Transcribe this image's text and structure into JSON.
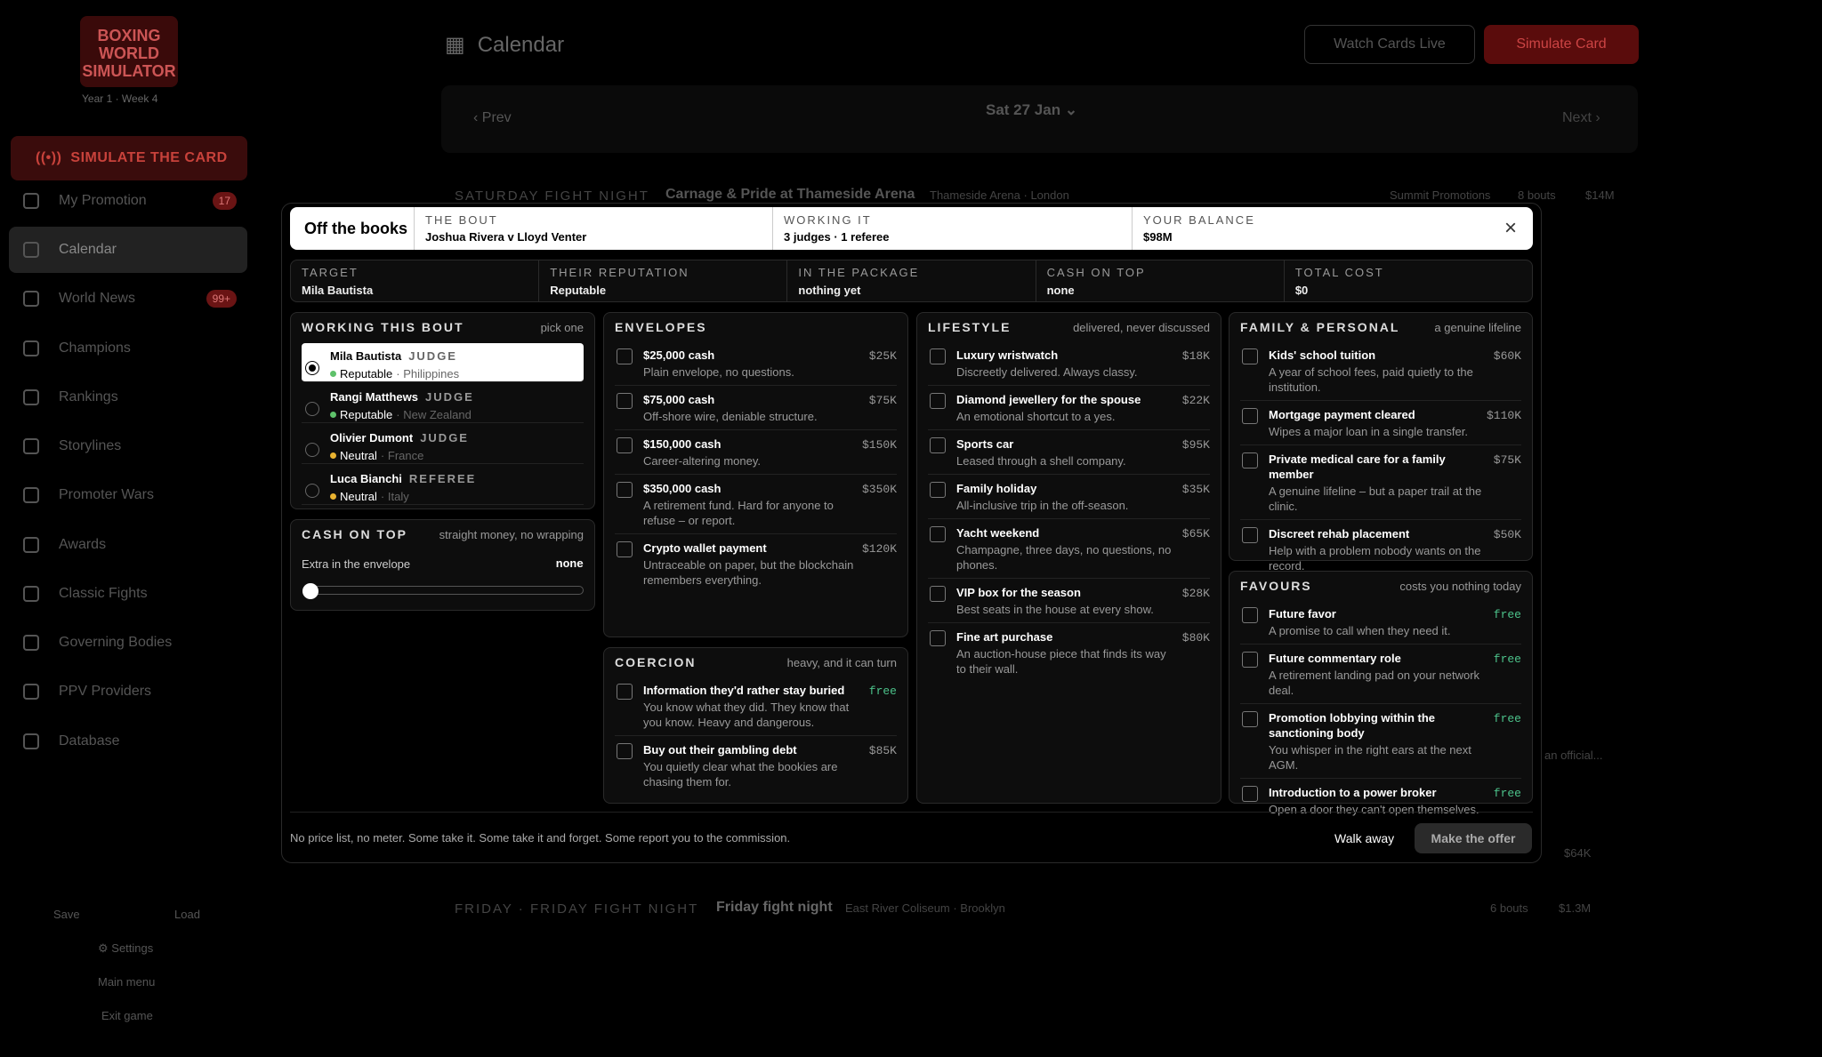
{
  "sidebar": {
    "logo_text": "BOXING WORLD SIMULATOR",
    "year_week": "Year 1 · Week 4",
    "simulate_label": "SIMULATE THE CARD",
    "items": [
      {
        "label": "My Promotion",
        "badge": "17"
      },
      {
        "label": "Calendar",
        "badge": ""
      },
      {
        "label": "World News",
        "badge": "99+"
      },
      {
        "label": "Champions",
        "badge": ""
      },
      {
        "label": "Rankings",
        "badge": ""
      },
      {
        "label": "Storylines",
        "badge": ""
      },
      {
        "label": "Promoter Wars",
        "badge": ""
      },
      {
        "label": "Awards",
        "badge": ""
      },
      {
        "label": "Classic Fights",
        "badge": ""
      },
      {
        "label": "Governing Bodies",
        "badge": ""
      },
      {
        "label": "PPV Providers",
        "badge": ""
      },
      {
        "label": "Database",
        "badge": ""
      }
    ],
    "save": "Save",
    "load": "Load",
    "settings": "Settings",
    "main_menu": "Main menu",
    "exit": "Exit game"
  },
  "header": {
    "title": "Calendar",
    "watch": "Watch Cards Live",
    "simulate": "Simulate Card"
  },
  "datebar": {
    "prev": "Prev",
    "date": "Sat 27 Jan",
    "next": "Next"
  },
  "events": [
    {
      "head": "SATURDAY FIGHT NIGHT",
      "name": "Carnage & Pride at Thameside Arena",
      "venue": "Thameside Arena · London",
      "promoter": "Summit Promotions",
      "bouts": "8 bouts",
      "cost": "$14M"
    },
    {
      "head": "FRIDAY · FRIDAY FIGHT NIGHT",
      "name": "Friday fight night",
      "venue": "East River Coliseum · Brooklyn",
      "bouts": "6 bouts",
      "cost": "$1.3M"
    }
  ],
  "bg_misc": {
    "official": "an official...",
    "cost": "$64K"
  },
  "modal": {
    "title": "Off the books",
    "bout_label": "THE BOUT",
    "bout": "Joshua Rivera v Lloyd Venter",
    "working_label": "WORKING IT",
    "working": "3 judges · 1 referee",
    "balance_label": "YOUR BALANCE",
    "balance": "$98M",
    "close": "×",
    "summary": [
      {
        "label": "TARGET",
        "value": "Mila Bautista"
      },
      {
        "label": "THEIR REPUTATION",
        "value": "Reputable"
      },
      {
        "label": "IN THE PACKAGE",
        "value": "nothing yet"
      },
      {
        "label": "CASH ON TOP",
        "value": "none"
      },
      {
        "label": "TOTAL COST",
        "value": "$0"
      }
    ],
    "officials": {
      "title": "WORKING THIS BOUT",
      "subtitle": "pick one",
      "list": [
        {
          "name": "Mila Bautista",
          "role": "JUDGE",
          "rep": "Reputable",
          "country": "Philippines",
          "dot": "#5ec16a"
        },
        {
          "name": "Rangi Matthews",
          "role": "JUDGE",
          "rep": "Reputable",
          "country": "New Zealand",
          "dot": "#5ec16a"
        },
        {
          "name": "Olivier Dumont",
          "role": "JUDGE",
          "rep": "Neutral",
          "country": "France",
          "dot": "#e8b230"
        },
        {
          "name": "Luca Bianchi",
          "role": "REFEREE",
          "rep": "Neutral",
          "country": "Italy",
          "dot": "#e8b230"
        }
      ]
    },
    "cash": {
      "title": "CASH ON TOP",
      "subtitle": "straight money, no wrapping",
      "label": "Extra in the envelope",
      "value": "none",
      "level": 0
    },
    "envelopes": {
      "title": "ENVELOPES",
      "subtitle": "",
      "items": [
        {
          "title": "$25,000 cash",
          "desc": "Plain envelope, no questions.",
          "price": "$25K"
        },
        {
          "title": "$75,000 cash",
          "desc": "Off-shore wire, deniable structure.",
          "price": "$75K"
        },
        {
          "title": "$150,000 cash",
          "desc": "Career-altering money.",
          "price": "$150K"
        },
        {
          "title": "$350,000 cash",
          "desc": "A retirement fund. Hard for anyone to refuse – or report.",
          "price": "$350K"
        },
        {
          "title": "Crypto wallet payment",
          "desc": "Untraceable on paper, but the blockchain remembers everything.",
          "price": "$120K"
        }
      ]
    },
    "coercion": {
      "title": "COERCION",
      "subtitle": "heavy, and it can turn",
      "items": [
        {
          "title": "Information they'd rather stay buried",
          "desc": "You know what they did. They know that you know. Heavy and dangerous.",
          "price": "free"
        },
        {
          "title": "Buy out their gambling debt",
          "desc": "You quietly clear what the bookies are chasing them for.",
          "price": "$85K"
        }
      ]
    },
    "lifestyle": {
      "title": "LIFESTYLE",
      "subtitle": "delivered, never discussed",
      "items": [
        {
          "title": "Luxury wristwatch",
          "desc": "Discreetly delivered. Always classy.",
          "price": "$18K"
        },
        {
          "title": "Diamond jewellery for the spouse",
          "desc": "An emotional shortcut to a yes.",
          "price": "$22K"
        },
        {
          "title": "Sports car",
          "desc": "Leased through a shell company.",
          "price": "$95K"
        },
        {
          "title": "Family holiday",
          "desc": "All-inclusive trip in the off-season.",
          "price": "$35K"
        },
        {
          "title": "Yacht weekend",
          "desc": "Champagne, three days, no questions, no phones.",
          "price": "$65K"
        },
        {
          "title": "VIP box for the season",
          "desc": "Best seats in the house at every show.",
          "price": "$28K"
        },
        {
          "title": "Fine art purchase",
          "desc": "An auction-house piece that finds its way to their wall.",
          "price": "$80K"
        }
      ]
    },
    "family": {
      "title": "FAMILY & PERSONAL",
      "subtitle": "a genuine lifeline",
      "items": [
        {
          "title": "Kids' school tuition",
          "desc": "A year of school fees, paid quietly to the institution.",
          "price": "$60K"
        },
        {
          "title": "Mortgage payment cleared",
          "desc": "Wipes a major loan in a single transfer.",
          "price": "$110K"
        },
        {
          "title": "Private medical care for a family member",
          "desc": "A genuine lifeline – but a paper trail at the clinic.",
          "price": "$75K"
        },
        {
          "title": "Discreet rehab placement",
          "desc": "Help with a problem nobody wants on the record.",
          "price": "$50K"
        }
      ]
    },
    "favours": {
      "title": "FAVOURS",
      "subtitle": "costs you nothing today",
      "items": [
        {
          "title": "Future favor",
          "desc": "A promise to call when they need it.",
          "price": "free"
        },
        {
          "title": "Future commentary role",
          "desc": "A retirement landing pad on your network deal.",
          "price": "free"
        },
        {
          "title": "Promotion lobbying within the sanctioning body",
          "desc": "You whisper in the right ears at the next AGM.",
          "price": "free"
        },
        {
          "title": "Introduction to a power broker",
          "desc": "Open a door they can't open themselves.",
          "price": "free"
        }
      ]
    },
    "footer": {
      "text": "No price list, no meter. Some take it. Some take it and forget. Some report you to the commission.",
      "walk": "Walk away",
      "make": "Make the offer"
    }
  }
}
